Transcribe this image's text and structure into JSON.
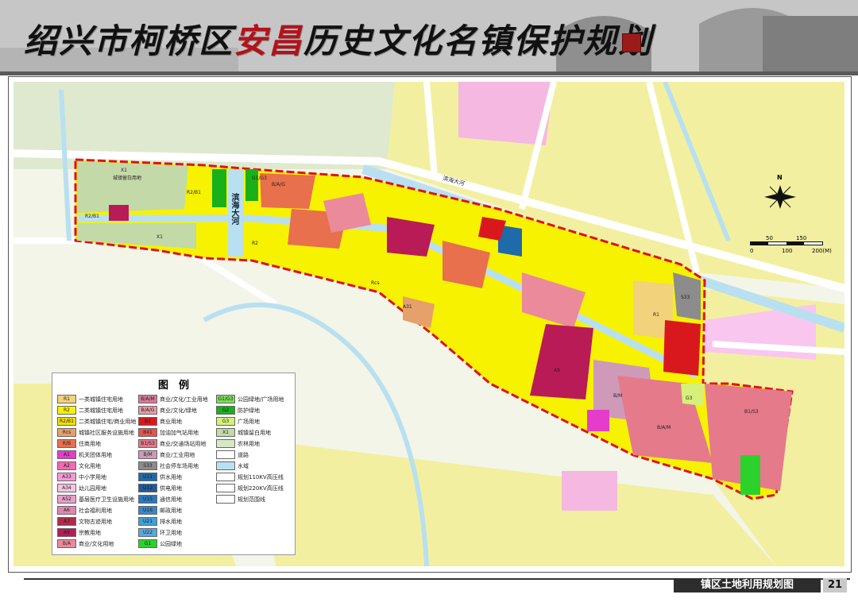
{
  "title": {
    "part1": "绍兴市柯桥区",
    "highlight": "安昌",
    "part2": "历史文化名镇保护规划"
  },
  "footer": {
    "caption": "镇区土地利用规划图",
    "page": "21"
  },
  "compass": {
    "north_label": "N"
  },
  "scale": {
    "ticks": [
      "0",
      "50",
      "100",
      "150",
      "200(M)"
    ]
  },
  "legend": {
    "title": "图　例",
    "col1": [
      {
        "code": "R1",
        "label": "一类城镇住宅用地",
        "color": "#f2d27a"
      },
      {
        "code": "R2",
        "label": "二类城镇住宅用地",
        "color": "#f7f200"
      },
      {
        "code": "R2/B1",
        "label": "二类城镇住宅/商业用地",
        "color": "#f2e200"
      },
      {
        "code": "Rcs",
        "label": "城镇社区服务设施用地",
        "color": "#e6a06a"
      },
      {
        "code": "R/B",
        "label": "住商用地",
        "color": "#e8704c"
      },
      {
        "code": "A1",
        "label": "机关团体用地",
        "color": "#e53dc9"
      },
      {
        "code": "A2",
        "label": "文化用地",
        "color": "#f06ab0"
      },
      {
        "code": "A33",
        "label": "中小学用地",
        "color": "#f59ad6"
      },
      {
        "code": "A34",
        "label": "幼儿园用地",
        "color": "#f7c5e0"
      },
      {
        "code": "A52",
        "label": "基层医疗卫生设施用地",
        "color": "#e6a0c8"
      },
      {
        "code": "A6",
        "label": "社会福利用地",
        "color": "#e085b0"
      },
      {
        "code": "A7",
        "label": "文物古迹用地",
        "color": "#b02a4a"
      },
      {
        "code": "A9",
        "label": "宗教用地",
        "color": "#b81b55"
      },
      {
        "code": "B/A",
        "label": "商业/文化用地",
        "color": "#eb8a9a"
      }
    ],
    "col2": [
      {
        "code": "B/A/M",
        "label": "商业/文化/工业用地",
        "color": "#d97a9a"
      },
      {
        "code": "B/A/G",
        "label": "商业/文化/绿地",
        "color": "#e89aa8"
      },
      {
        "code": "B1",
        "label": "商业用地",
        "color": "#d9181e"
      },
      {
        "code": "B41",
        "label": "加油加气站用地",
        "color": "#e3554e"
      },
      {
        "code": "B1/S3",
        "label": "商业/交通场站用地",
        "color": "#e57a8a"
      },
      {
        "code": "B/M",
        "label": "商业/工业用地",
        "color": "#cf9ab8"
      },
      {
        "code": "S33",
        "label": "社会停车场用地",
        "color": "#8c8c8c"
      },
      {
        "code": "U11",
        "label": "供水用地",
        "color": "#1f6aa8"
      },
      {
        "code": "U12",
        "label": "供电用地",
        "color": "#205a9a"
      },
      {
        "code": "U15",
        "label": "通信用地",
        "color": "#2a78c0"
      },
      {
        "code": "U16",
        "label": "邮政用地",
        "color": "#3a86c8"
      },
      {
        "code": "U21",
        "label": "排水用地",
        "color": "#3fa0d8"
      },
      {
        "code": "U22",
        "label": "环卫用地",
        "color": "#58a8e0"
      },
      {
        "code": "G1",
        "label": "公园绿地",
        "color": "#2bd22b"
      }
    ],
    "col3": [
      {
        "code": "G1/G3",
        "label": "公园绿地/广场用地",
        "color": "#7ddc5a"
      },
      {
        "code": "G2",
        "label": "防护绿地",
        "color": "#19b019"
      },
      {
        "code": "G3",
        "label": "广场用地",
        "color": "#d6f07a"
      },
      {
        "code": "X1",
        "label": "城镇留白用地",
        "color": "#c3d9a8"
      },
      {
        "code": "",
        "label": "农林用地",
        "color": "#d7e8c3"
      },
      {
        "code": "",
        "label": "道路",
        "color": "#ffffff"
      },
      {
        "code": "",
        "label": "水域",
        "color": "#b9e0f0"
      },
      {
        "code": "",
        "label": "规划110KV高压线",
        "color": "#ffffff"
      },
      {
        "code": "",
        "label": "规划220KV高压线",
        "color": "#ffffff"
      },
      {
        "code": "",
        "label": "规划范围线",
        "color": "#ffffff"
      }
    ]
  },
  "map_labels": {
    "river1": "滨海大河",
    "river2": "滨海大河",
    "x1_top": "X1",
    "x1_bottom": "X1",
    "x1_sub": "城镇留白用地",
    "r1": "R1",
    "b1s3": "B1/S3",
    "s33": "S33",
    "g3": "G3",
    "bam": "B/A/M",
    "bm": "B/M",
    "a9": "A9",
    "r2b1a": "R2/B1",
    "r2b1b": "R2/B1",
    "r2c": "R2",
    "bag": "B/A/G",
    "g1g3": "G1/G3",
    "a31": "A31",
    "rcs": "Rcs"
  },
  "colors": {
    "boundary": "#e0101e",
    "river": "#b9e0f0",
    "road": "#ffffff",
    "farmland": "#f2f0a0"
  }
}
